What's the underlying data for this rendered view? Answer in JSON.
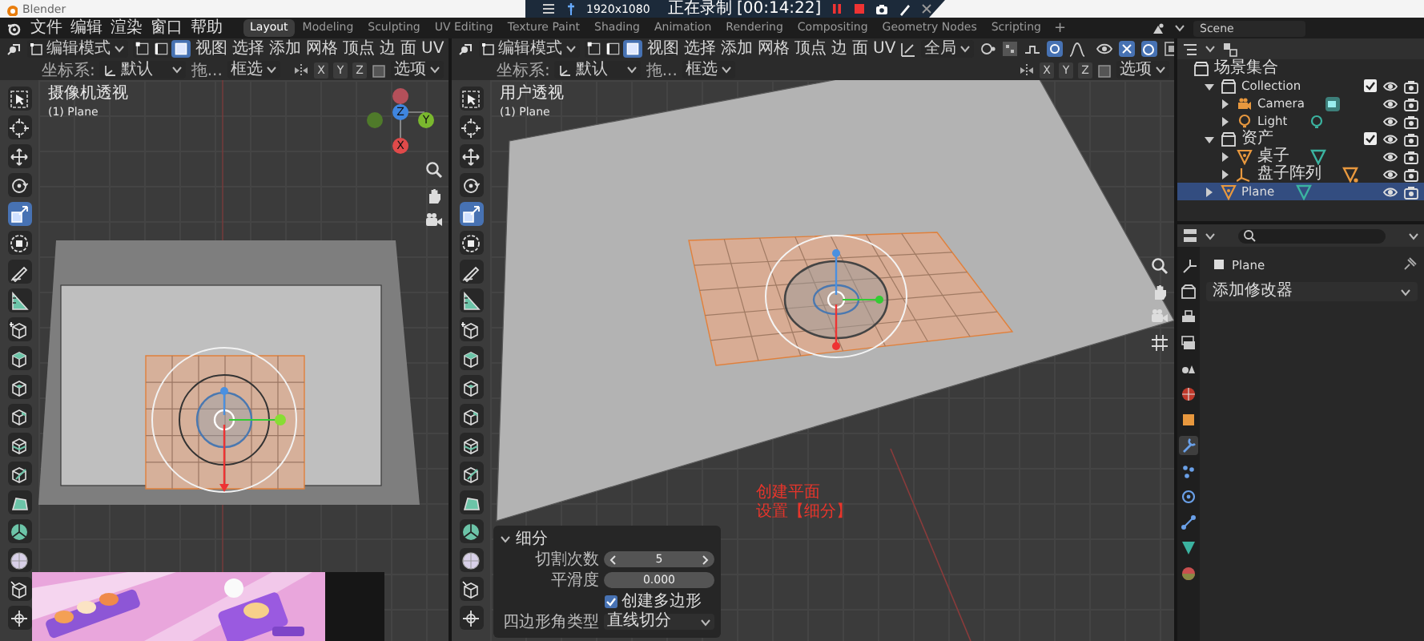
{
  "title_bar": {
    "title": "Blender"
  },
  "recorder": {
    "resolution": "1920x1080",
    "status": "正在录制 [00:14:22]"
  },
  "menu": [
    "文件",
    "编辑",
    "渲染",
    "窗口",
    "帮助"
  ],
  "workspaces": [
    {
      "label": "Layout",
      "selected": true
    },
    {
      "label": "Modeling",
      "selected": false
    },
    {
      "label": "Sculpting",
      "selected": false
    },
    {
      "label": "UV Editing",
      "selected": false
    },
    {
      "label": "Texture Paint",
      "selected": false
    },
    {
      "label": "Shading",
      "selected": false
    },
    {
      "label": "Animation",
      "selected": false
    },
    {
      "label": "Rendering",
      "selected": false
    },
    {
      "label": "Compositing",
      "selected": false
    },
    {
      "label": "Geometry Nodes",
      "selected": false
    },
    {
      "label": "Scripting",
      "selected": false
    }
  ],
  "add_workspace": "+",
  "scene": "Scene",
  "viewports": [
    {
      "kind": "camera_view",
      "mode": "编辑模式",
      "select_modes": [
        {
          "kind": "vertex",
          "selected": false
        },
        {
          "kind": "edge",
          "selected": false
        },
        {
          "kind": "face",
          "selected": true
        }
      ],
      "menus": [
        "视图",
        "选择",
        "添加",
        "网格",
        "顶点",
        "边",
        "面",
        "UV"
      ],
      "coord_label": "坐标系:",
      "coord_value": "默认",
      "drag_label": "拖...",
      "drag_value": "框选",
      "axes": [
        "X",
        "Y",
        "Z"
      ],
      "options": "选项",
      "view_name": "摄像机透视",
      "object": "(1) Plane",
      "gizmo_axes": [
        "Z",
        "Y",
        "X"
      ],
      "tools": [
        {
          "kind": "select",
          "selected": false
        },
        {
          "kind": "cursor",
          "selected": false
        },
        {
          "kind": "move",
          "selected": false
        },
        {
          "kind": "rotate",
          "selected": false
        },
        {
          "kind": "scale",
          "selected": true
        },
        {
          "kind": "transform",
          "selected": false
        },
        {
          "kind": "annotate",
          "selected": false
        },
        {
          "kind": "measure",
          "selected": false
        },
        {
          "kind": "add-cube",
          "selected": false
        },
        {
          "kind": "extrude",
          "selected": false
        },
        {
          "kind": "inset",
          "selected": false
        },
        {
          "kind": "bevel",
          "selected": false
        },
        {
          "kind": "loop-cut",
          "selected": false
        },
        {
          "kind": "knife",
          "selected": false
        },
        {
          "kind": "poly-build",
          "selected": false
        },
        {
          "kind": "spin",
          "selected": false
        },
        {
          "kind": "smooth",
          "selected": false
        },
        {
          "kind": "shrink",
          "selected": false
        },
        {
          "kind": "rip",
          "selected": false
        }
      ],
      "video_overlay": {
        "kind": "picture"
      }
    },
    {
      "kind": "user_view",
      "mode": "编辑模式",
      "select_modes": [
        {
          "kind": "vertex",
          "selected": false
        },
        {
          "kind": "edge",
          "selected": false
        },
        {
          "kind": "face",
          "selected": true
        }
      ],
      "menus": [
        "视图",
        "选择",
        "添加",
        "网格",
        "顶点",
        "边",
        "面",
        "UV"
      ],
      "orientation": "全局",
      "coord_label": "坐标系:",
      "coord_value": "默认",
      "drag_label": "拖...",
      "drag_value": "框选",
      "axes": [
        "X",
        "Y",
        "Z"
      ],
      "options": "选项",
      "view_name": "用户透视",
      "object": "(1) Plane",
      "tools": [
        {
          "kind": "select",
          "selected": false
        },
        {
          "kind": "cursor",
          "selected": false
        },
        {
          "kind": "move",
          "selected": false
        },
        {
          "kind": "rotate",
          "selected": false
        },
        {
          "kind": "scale",
          "selected": true
        },
        {
          "kind": "transform",
          "selected": false
        },
        {
          "kind": "annotate",
          "selected": false
        },
        {
          "kind": "measure",
          "selected": false
        },
        {
          "kind": "add-cube",
          "selected": false
        },
        {
          "kind": "extrude",
          "selected": false
        },
        {
          "kind": "inset",
          "selected": false
        },
        {
          "kind": "bevel",
          "selected": false
        },
        {
          "kind": "loop-cut",
          "selected": false
        },
        {
          "kind": "knife",
          "selected": false
        },
        {
          "kind": "poly-build",
          "selected": false
        },
        {
          "kind": "spin",
          "selected": false
        },
        {
          "kind": "smooth",
          "selected": false
        },
        {
          "kind": "shrink",
          "selected": false
        },
        {
          "kind": "rip",
          "selected": false
        }
      ],
      "operator_panel": {
        "title": "细分",
        "fields": [
          {
            "kind": "number",
            "label": "切割次数",
            "value": "5"
          },
          {
            "kind": "slider",
            "label": "平滑度",
            "value": "0.000"
          },
          {
            "kind": "checkbox",
            "label": "创建多边形",
            "checked": true
          },
          {
            "kind": "dropdown",
            "label": "四边形角类型",
            "value": "直线切分"
          }
        ]
      },
      "annotation": [
        "创建平面",
        "设置【细分】"
      ]
    }
  ],
  "outliner": {
    "root": "场景集合",
    "items": [
      {
        "kind": "collection",
        "name": "Collection",
        "expanded": true,
        "selected": false,
        "checked": true,
        "children": [
          {
            "kind": "camera",
            "name": "Camera",
            "expanded": false,
            "selected": false
          },
          {
            "kind": "light",
            "name": "Light",
            "expanded": false,
            "selected": false
          }
        ]
      },
      {
        "kind": "collection",
        "name": "资产",
        "expanded": true,
        "selected": false,
        "checked": true,
        "children": [
          {
            "kind": "mesh",
            "name": "桌子",
            "expanded": false,
            "selected": false
          },
          {
            "kind": "empty",
            "name": "盘子阵列",
            "expanded": false,
            "selected": false
          }
        ]
      },
      {
        "kind": "mesh",
        "name": "Plane",
        "expanded": false,
        "selected": true
      }
    ]
  },
  "properties": {
    "object": "Plane",
    "add_modifier": "添加修改器",
    "tabs": [
      {
        "kind": "tool",
        "selected": false
      },
      {
        "kind": "render",
        "selected": false
      },
      {
        "kind": "output",
        "selected": false
      },
      {
        "kind": "view-layer",
        "selected": false
      },
      {
        "kind": "scene",
        "selected": false
      },
      {
        "kind": "world",
        "selected": false
      },
      {
        "kind": "object",
        "selected": false
      },
      {
        "kind": "modifier",
        "selected": true
      },
      {
        "kind": "particles",
        "selected": false
      },
      {
        "kind": "physics",
        "selected": false
      },
      {
        "kind": "constraints",
        "selected": false
      },
      {
        "kind": "data",
        "selected": false
      },
      {
        "kind": "material",
        "selected": false
      }
    ]
  }
}
